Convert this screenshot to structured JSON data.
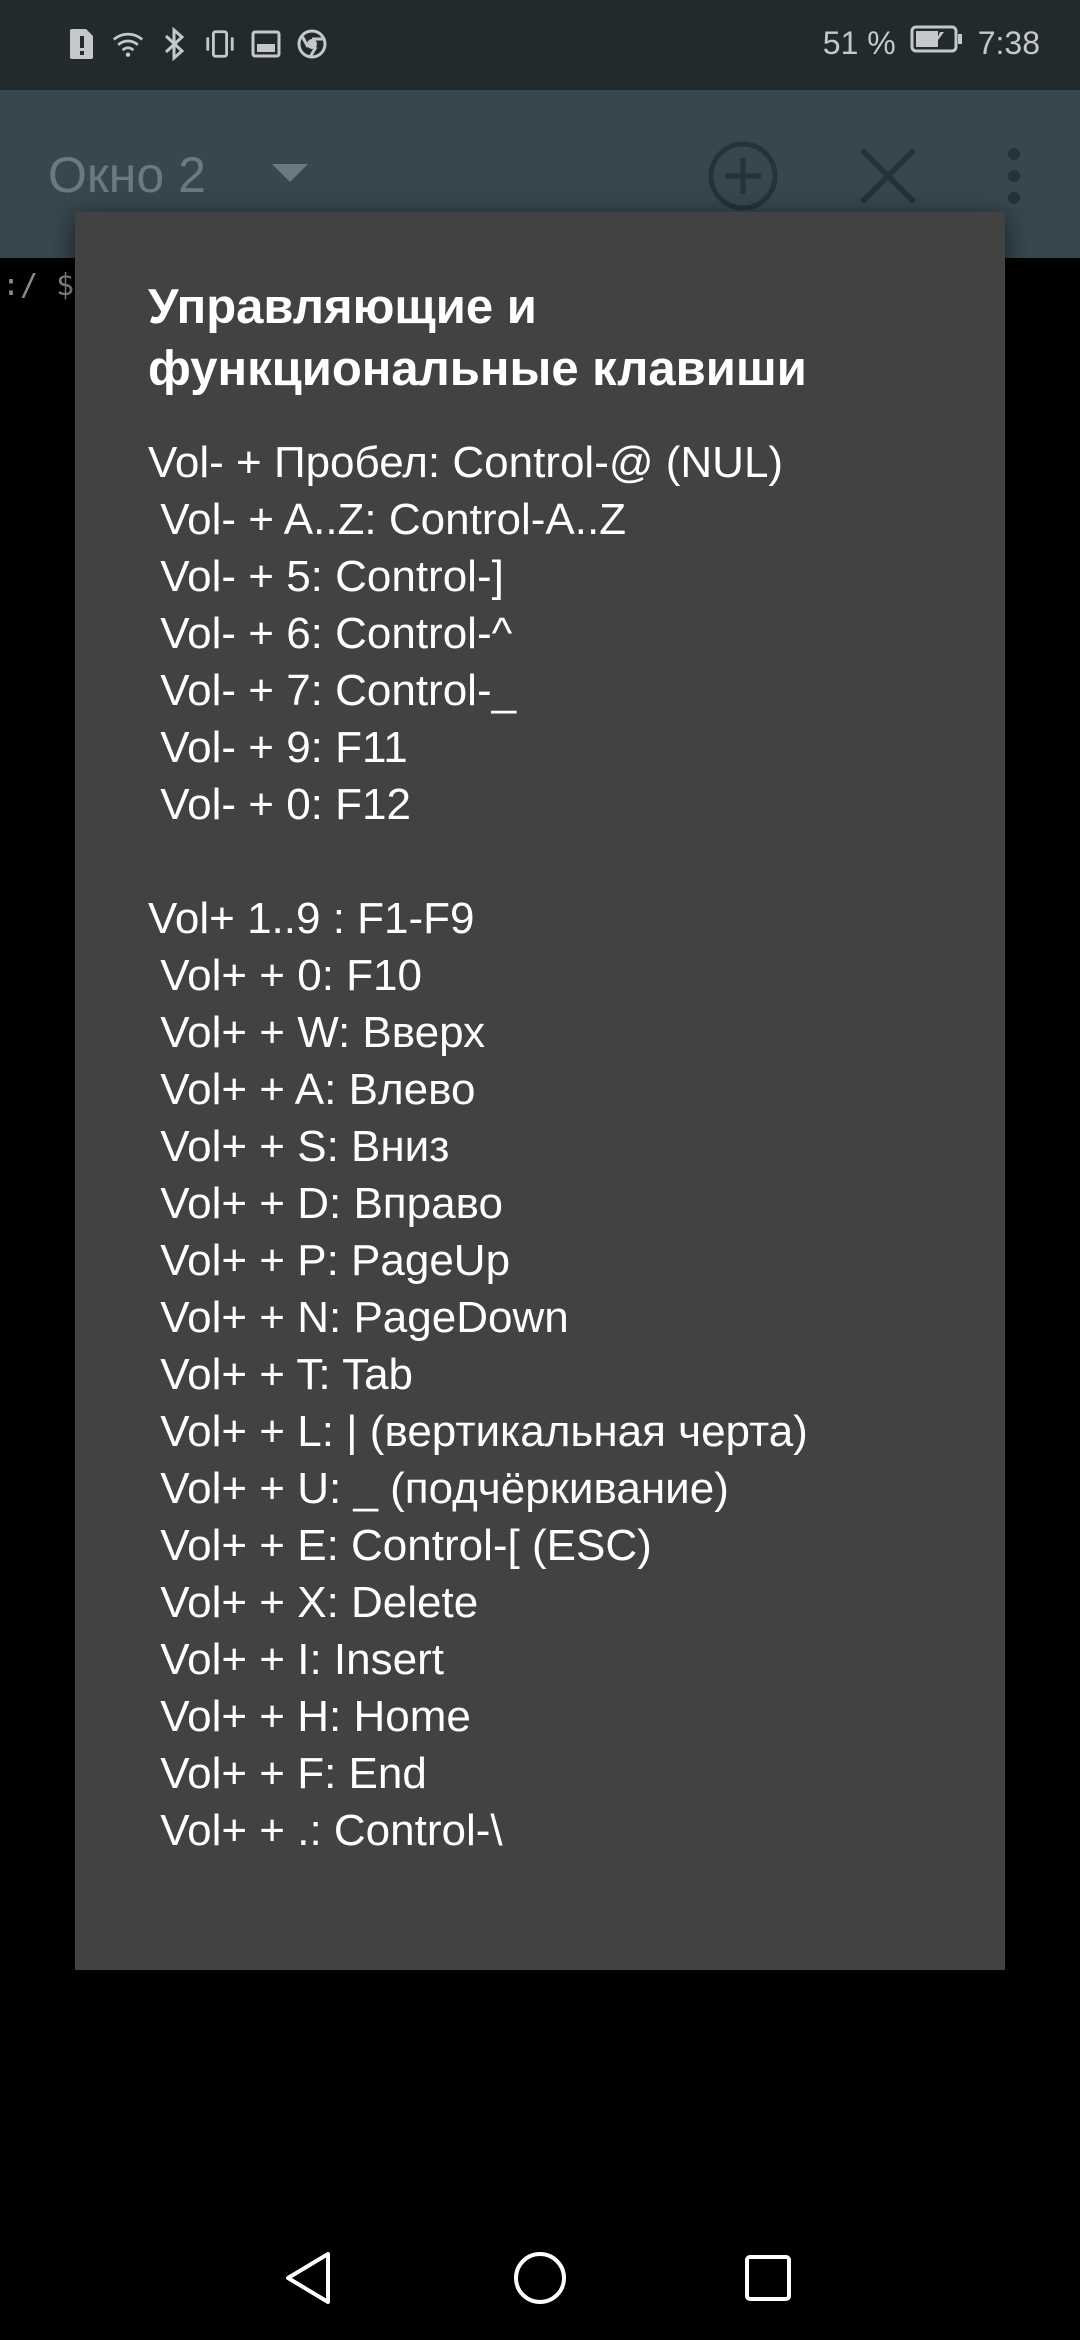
{
  "status_bar": {
    "battery_percent": "51 %",
    "time": "7:38",
    "icons": [
      "sim-alert-icon",
      "wifi-icon",
      "bluetooth-icon",
      "vibrate-icon",
      "screenshot-icon",
      "chrome-icon",
      "battery-icon"
    ]
  },
  "app_bar": {
    "window_title": "Окно 2",
    "icons": [
      "dropdown-arrow-icon",
      "add-circle-icon",
      "close-icon",
      "more-vert-icon"
    ]
  },
  "terminal": {
    "prompt": ":/ $"
  },
  "dialog": {
    "title": "Управляющие и функциональные клавиши",
    "body": "Vol- + Пробел: Control-@ (NUL)\n Vol- + A..Z: Control-A..Z\n Vol- + 5: Control-]\n Vol- + 6: Control-^\n Vol- + 7: Control-_\n Vol- + 9: F11\n Vol- + 0: F12\n\nVol+ 1..9 : F1-F9\n Vol+ + 0: F10\n Vol+ + W: Вверх\n Vol+ + A: Влево\n Vol+ + S: Вниз\n Vol+ + D: Вправо\n Vol+ + P: PageUp\n Vol+ + N: PageDown\n Vol+ + T: Tab\n Vol+ + L: | (вертикальная черта)\n Vol+ + U: _ (подчёркивание)\n Vol+ + E: Control-[ (ESC)\n Vol+ + X: Delete\n Vol+ + I: Insert\n Vol+ + H: Home\n Vol+ + F: End\n Vol+ + .: Control-\\"
  },
  "nav_bar": {
    "icons": [
      "back-icon",
      "home-icon",
      "recents-icon"
    ]
  },
  "colors": {
    "app_bar": "#37474f",
    "status_bar": "#232a2d",
    "dialog": "#424242",
    "terminal": "#000000"
  }
}
